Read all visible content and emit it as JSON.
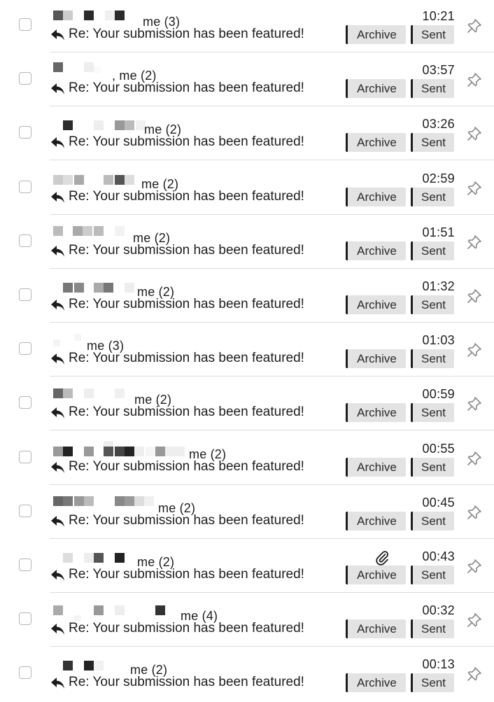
{
  "colors": {
    "button_bg": "#e3e3e3",
    "button_border": "#1d1d1d",
    "divider": "#dcdcdc",
    "text": "#1d1d1d",
    "icon": "#8a8a8a"
  },
  "icons": {
    "reply": "reply-arrow-icon",
    "pin": "pin-icon",
    "attachment": "paperclip-icon",
    "checkbox": "checkbox-icon"
  },
  "threads": [
    {
      "senders": "me (3)",
      "subject": "Re: Your submission has been featured!",
      "time": "10:21",
      "archive_label": "Archive",
      "sent_label": "Sent",
      "has_attachment": false
    },
    {
      "senders": ", me (2)",
      "subject": "Re: Your submission has been featured!",
      "time": "03:57",
      "archive_label": "Archive",
      "sent_label": "Sent",
      "has_attachment": false
    },
    {
      "senders": "me (2)",
      "subject": "Re: Your submission has been featured!",
      "time": "03:26",
      "archive_label": "Archive",
      "sent_label": "Sent",
      "has_attachment": false
    },
    {
      "senders": "me (2)",
      "subject": "Re: Your submission has been featured!",
      "time": "02:59",
      "archive_label": "Archive",
      "sent_label": "Sent",
      "has_attachment": false
    },
    {
      "senders": "me (2)",
      "subject": "Re: Your submission has been featured!",
      "time": "01:51",
      "archive_label": "Archive",
      "sent_label": "Sent",
      "has_attachment": false
    },
    {
      "senders": "me (2)",
      "subject": "Re: Your submission has been featured!",
      "time": "01:32",
      "archive_label": "Archive",
      "sent_label": "Sent",
      "has_attachment": false
    },
    {
      "senders": "me (3)",
      "subject": "Re: Your submission has been featured!",
      "time": "01:03",
      "archive_label": "Archive",
      "sent_label": "Sent",
      "has_attachment": false
    },
    {
      "senders": "me (2)",
      "subject": "Re: Your submission has been featured!",
      "time": "00:59",
      "archive_label": "Archive",
      "sent_label": "Sent",
      "has_attachment": false
    },
    {
      "senders": "me (2)",
      "subject": "Re: Your submission has been featured!",
      "time": "00:55",
      "archive_label": "Archive",
      "sent_label": "Sent",
      "has_attachment": false
    },
    {
      "senders": "me (2)",
      "subject": "Re: Your submission has been featured!",
      "time": "00:45",
      "archive_label": "Archive",
      "sent_label": "Sent",
      "has_attachment": false
    },
    {
      "senders": "me (2)",
      "subject": "Re: Your submission has been featured!",
      "time": "00:43",
      "archive_label": "Archive",
      "sent_label": "Sent",
      "has_attachment": true
    },
    {
      "senders": "me (4)",
      "subject": "Re: Your submission has been featured!",
      "time": "00:32",
      "archive_label": "Archive",
      "sent_label": "Sent",
      "has_attachment": false
    },
    {
      "senders": "me (2)",
      "subject": "Re: Your submission has been featured!",
      "time": "00:13",
      "archive_label": "Archive",
      "sent_label": "Sent",
      "has_attachment": false
    }
  ]
}
